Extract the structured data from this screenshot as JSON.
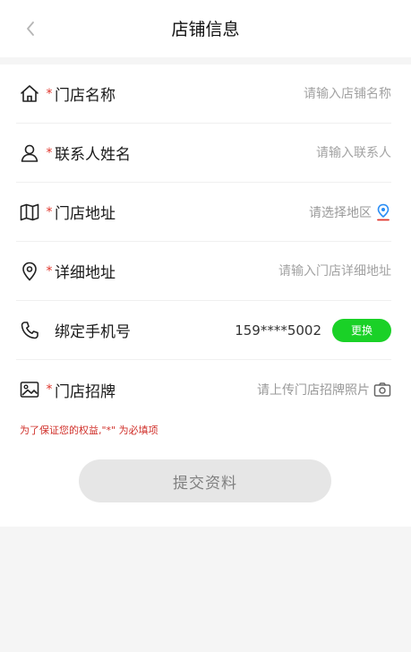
{
  "header": {
    "title": "店铺信息"
  },
  "rows": [
    {
      "label": "门店名称",
      "required": true,
      "placeholder": "请输入店铺名称",
      "icon": "home-icon"
    },
    {
      "label": "联系人姓名",
      "required": true,
      "placeholder": "请输入联系人",
      "icon": "person-icon"
    },
    {
      "label": "门店地址",
      "required": true,
      "placeholder": "请选择地区",
      "icon": "map-icon",
      "tail_icon": "location-pin-icon"
    },
    {
      "label": "详细地址",
      "required": true,
      "placeholder": "请输入门店详细地址",
      "icon": "location-icon"
    },
    {
      "label": "绑定手机号",
      "required": false,
      "value": "159****5002",
      "action": "更换",
      "icon": "phone-icon"
    },
    {
      "label": "门店招牌",
      "required": true,
      "placeholder": "请上传门店招牌照片",
      "icon": "image-icon",
      "tail_icon": "camera-icon"
    }
  ],
  "required_mark": "*",
  "notice": "为了保证您的权益,\"*\" 为必填项",
  "submit_label": "提交资料",
  "colors": {
    "accent_green": "#1ad127",
    "required_red": "#e0352b",
    "button_disabled": "#e6e6e6"
  }
}
